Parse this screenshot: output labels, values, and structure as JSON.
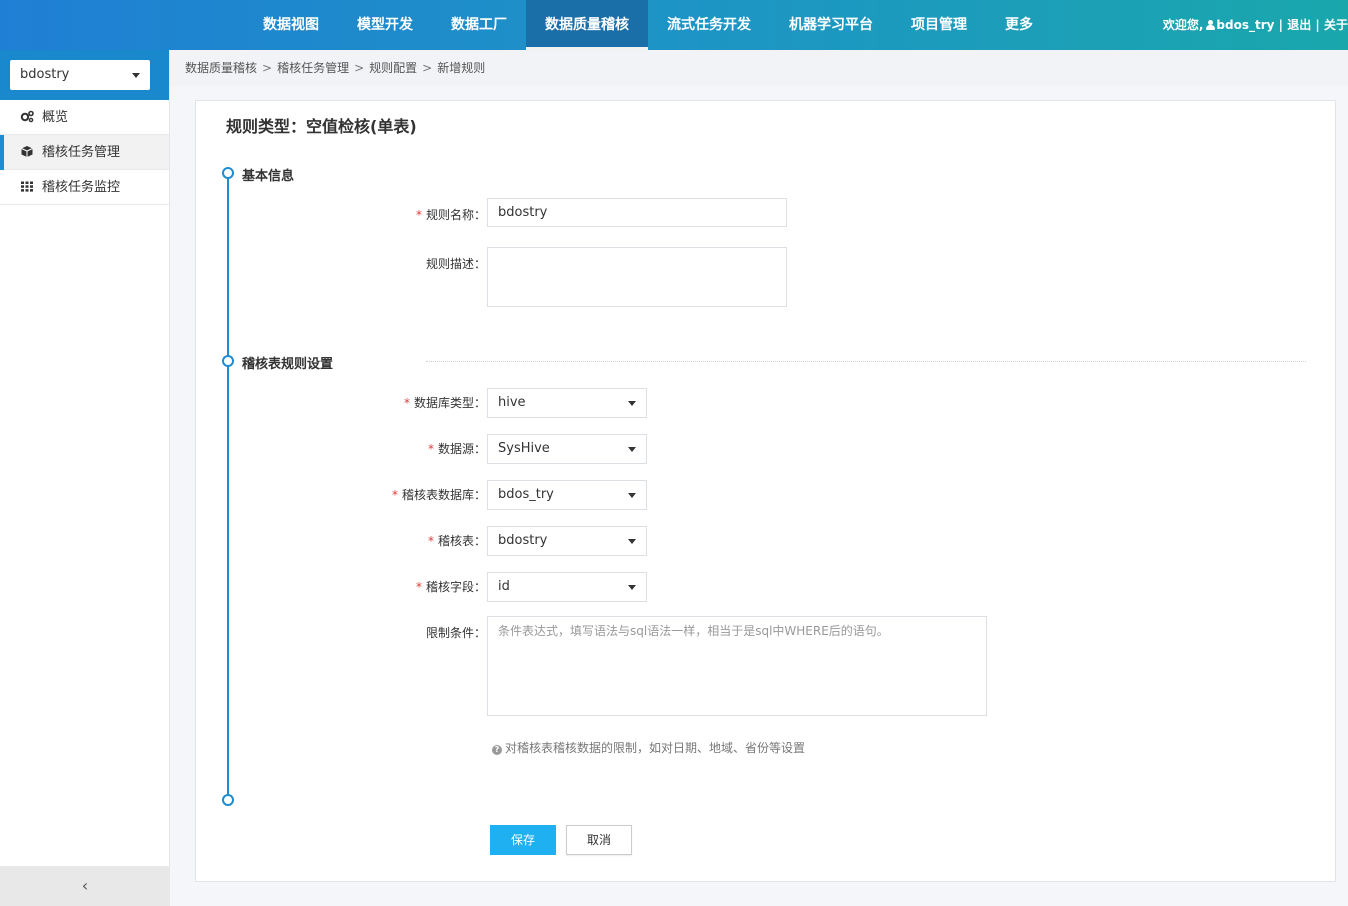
{
  "topnav": {
    "items": [
      "数据视图",
      "模型开发",
      "数据工厂",
      "数据质量稽核",
      "流式任务开发",
      "机器学习平台",
      "项目管理",
      "更多"
    ],
    "active_index": 3,
    "welcome": "欢迎您,",
    "username": "bdos_try",
    "logout": "退出",
    "about": "关于",
    "separator": "|"
  },
  "sidebar": {
    "project": "bdostry",
    "items": [
      {
        "label": "概览",
        "icon": "cogs-icon"
      },
      {
        "label": "稽核任务管理",
        "icon": "cube-icon"
      },
      {
        "label": "稽核任务监控",
        "icon": "grid-icon"
      }
    ],
    "active_index": 1,
    "collapse_glyph": "‹"
  },
  "breadcrumb": [
    "数据质量稽核",
    "稽核任务管理",
    "规则配置",
    "新增规则"
  ],
  "breadcrumb_sep": ">",
  "form": {
    "title": "规则类型：空值检核(单表)",
    "section_basic": "基本信息",
    "section_rule": "稽核表规则设置",
    "required_mark": "*",
    "rule_name": {
      "label": "规则名称：",
      "value": "bdostry"
    },
    "rule_desc": {
      "label": "规则描述：",
      "value": ""
    },
    "db_type": {
      "label": "数据库类型：",
      "value": "hive"
    },
    "data_source": {
      "label": "数据源：",
      "value": "SysHive"
    },
    "audit_db": {
      "label": "稽核表数据库：",
      "value": "bdos_try"
    },
    "audit_table": {
      "label": "稽核表：",
      "value": "bdostry"
    },
    "audit_field": {
      "label": "稽核字段：",
      "value": "id"
    },
    "condition": {
      "label": "限制条件：",
      "placeholder": "条件表达式，填写语法与sql语法一样，相当于是sql中WHERE后的语句。"
    },
    "hint_icon": "?",
    "hint": "对稽核表稽核数据的限制，如对日期、地域、省份等设置",
    "save": "保存",
    "cancel": "取消"
  },
  "colors": {
    "accent": "#1f8bd0",
    "primary_button": "#1eb0f0",
    "required": "#e23b3b"
  }
}
